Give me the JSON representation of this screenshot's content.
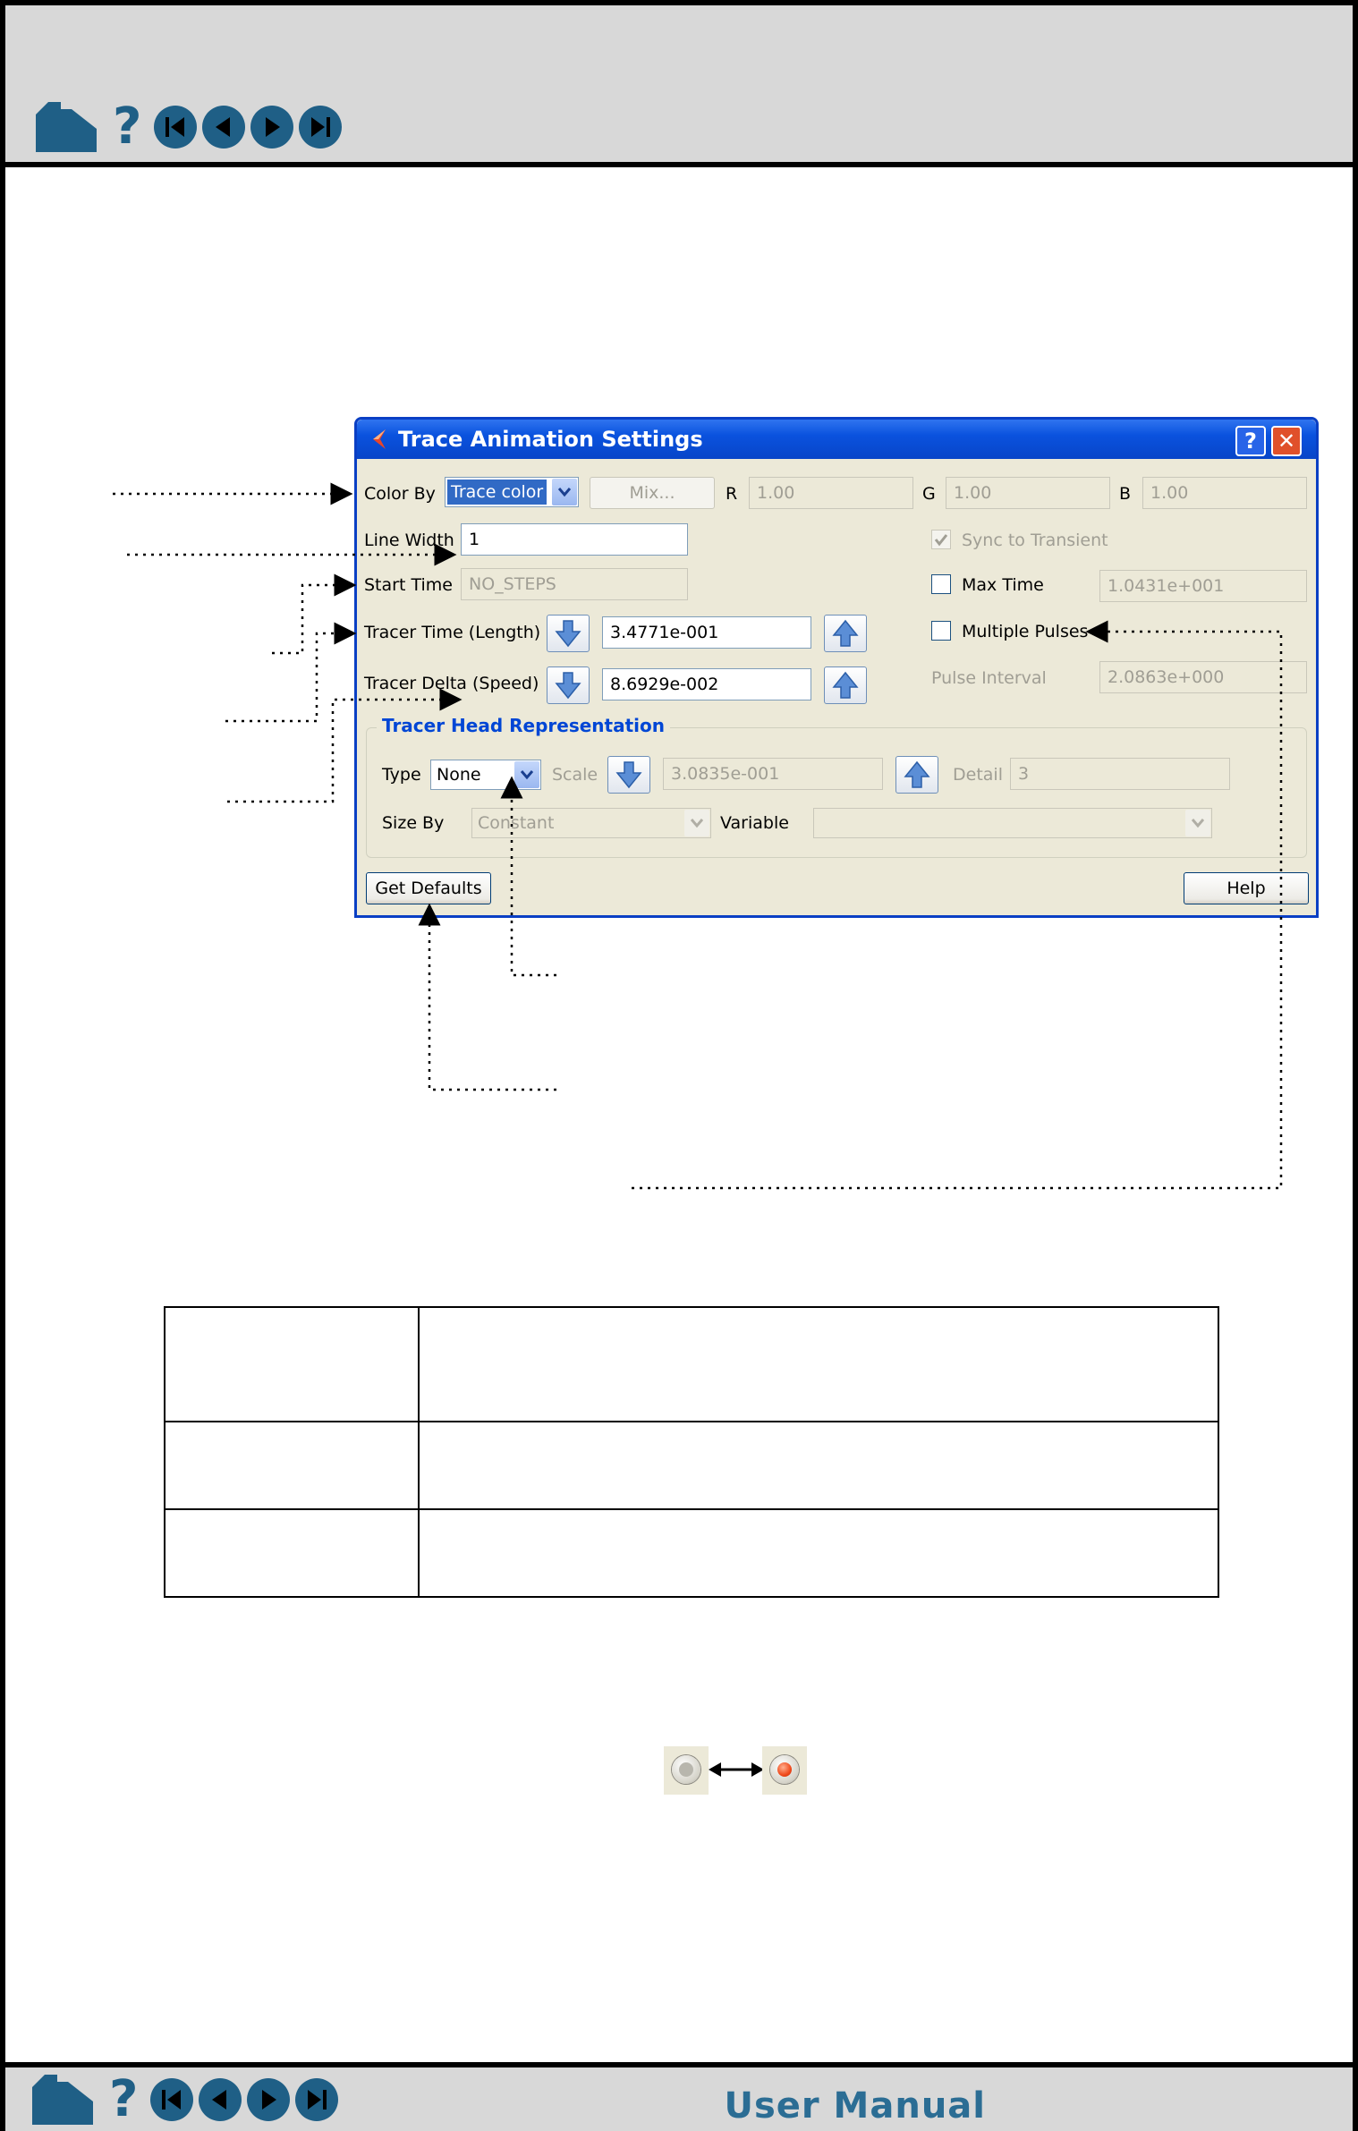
{
  "footer": {
    "title": "User Manual"
  },
  "dialog": {
    "title": "Trace Animation Settings",
    "help_glyph": "?",
    "close_glyph": "✕",
    "color_by_label": "Color By",
    "color_by_value": "Trace color",
    "mix_label": "Mix...",
    "r_label": "R",
    "r_value": "1.00",
    "g_label": "G",
    "g_value": "1.00",
    "b_label": "B",
    "b_value": "1.00",
    "line_width_label": "Line Width",
    "line_width_value": "1",
    "start_time_label": "Start Time",
    "start_time_value": "NO_STEPS",
    "tracer_time_label": "Tracer Time (Length)",
    "tracer_time_value": "3.4771e-001",
    "tracer_delta_label": "Tracer Delta (Speed)",
    "tracer_delta_value": "8.6929e-002",
    "sync_label": "Sync to Transient",
    "max_time_label": "Max Time",
    "max_time_value": "1.0431e+001",
    "multiple_pulses_label": "Multiple Pulses",
    "pulse_interval_label": "Pulse Interval",
    "pulse_interval_value": "2.0863e+000",
    "group_title": "Tracer Head Representation",
    "type_label": "Type",
    "type_value": "None",
    "scale_label": "Scale",
    "scale_value": "3.0835e-001",
    "detail_label": "Detail",
    "detail_value": "3",
    "size_by_label": "Size By",
    "size_by_value": "Constant",
    "variable_label": "Variable",
    "variable_value": "",
    "get_defaults_label": "Get Defaults",
    "help_label": "Help"
  },
  "colors": {
    "nav_blue": "#1f5f86",
    "title_bar": "#0a52de",
    "dialog_bg": "#ece9d8",
    "radio_off": "#b8b6ad",
    "radio_on": "#f04a1c"
  },
  "icons": [
    "house-icon",
    "question-icon",
    "first-page-icon",
    "previous-page-icon",
    "next-page-icon",
    "last-page-icon",
    "down-arrow-icon",
    "up-arrow-icon",
    "checkbox-check-icon",
    "radio-toggle-icon"
  ]
}
